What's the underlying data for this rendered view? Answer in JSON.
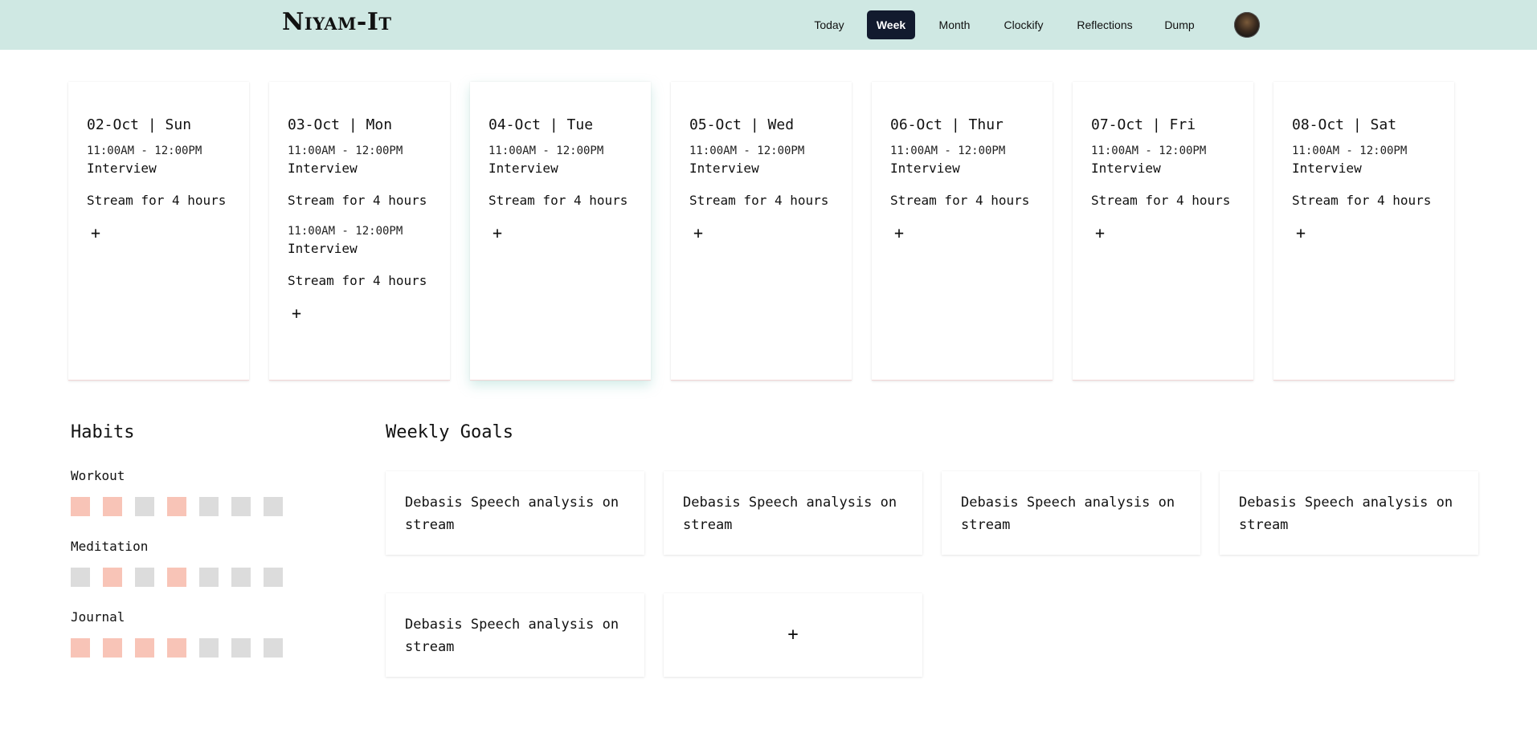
{
  "app": {
    "logo": "Niyam-It"
  },
  "nav": [
    {
      "label": "Today",
      "active": false
    },
    {
      "label": "Week",
      "active": true
    },
    {
      "label": "Month",
      "active": false
    },
    {
      "label": "Clockify",
      "active": false
    },
    {
      "label": "Reflections",
      "active": false
    },
    {
      "label": "Dump",
      "active": false
    }
  ],
  "days": [
    {
      "title": "02-Oct | Sun",
      "events": [
        {
          "time": "11:00AM - 12:00PM",
          "title": "Interview",
          "task": "Stream for 4 hours"
        }
      ]
    },
    {
      "title": "03-Oct | Mon",
      "events": [
        {
          "time": "11:00AM - 12:00PM",
          "title": "Interview",
          "task": "Stream for 4 hours"
        },
        {
          "time": "11:00AM - 12:00PM",
          "title": "Interview",
          "task": "Stream for 4 hours"
        }
      ]
    },
    {
      "title": "04-Oct | Tue",
      "events": [
        {
          "time": "11:00AM - 12:00PM",
          "title": "Interview",
          "task": "Stream for 4 hours"
        }
      ]
    },
    {
      "title": "05-Oct | Wed",
      "events": [
        {
          "time": "11:00AM - 12:00PM",
          "title": "Interview",
          "task": "Stream for 4 hours"
        }
      ]
    },
    {
      "title": "06-Oct | Thur",
      "events": [
        {
          "time": "11:00AM - 12:00PM",
          "title": "Interview",
          "task": "Stream for 4 hours"
        }
      ]
    },
    {
      "title": "07-Oct | Fri",
      "events": [
        {
          "time": "11:00AM - 12:00PM",
          "title": "Interview",
          "task": "Stream for 4 hours"
        }
      ]
    },
    {
      "title": "08-Oct | Sat",
      "events": [
        {
          "time": "11:00AM - 12:00PM",
          "title": "Interview",
          "task": "Stream for 4 hours"
        }
      ]
    }
  ],
  "add_symbol": "+",
  "habits": {
    "title": "Habits",
    "items": [
      {
        "name": "Workout",
        "days": [
          true,
          true,
          false,
          true,
          false,
          false,
          false
        ]
      },
      {
        "name": "Meditation",
        "days": [
          false,
          true,
          false,
          true,
          false,
          false,
          false
        ]
      },
      {
        "name": "Journal",
        "days": [
          true,
          true,
          true,
          true,
          false,
          false,
          false
        ]
      }
    ]
  },
  "goals": {
    "title": "Weekly Goals",
    "items": [
      "Debasis Speech analysis on stream",
      "Debasis Speech analysis on stream",
      "Debasis Speech analysis on stream",
      "Debasis Speech analysis on stream",
      "Debasis Speech analysis on stream"
    ]
  },
  "colors": {
    "header_bg": "#cfe8e3",
    "nav_active_bg": "#121a2e",
    "habit_done": "#f8c4b7",
    "habit_todo": "#dcdcdc"
  }
}
